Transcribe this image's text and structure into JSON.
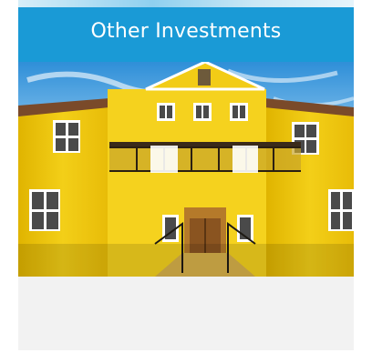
{
  "tile": {
    "title": "Other Investments",
    "accent_color": "#1a9ad6",
    "image_icon": "building-photo-icon"
  }
}
